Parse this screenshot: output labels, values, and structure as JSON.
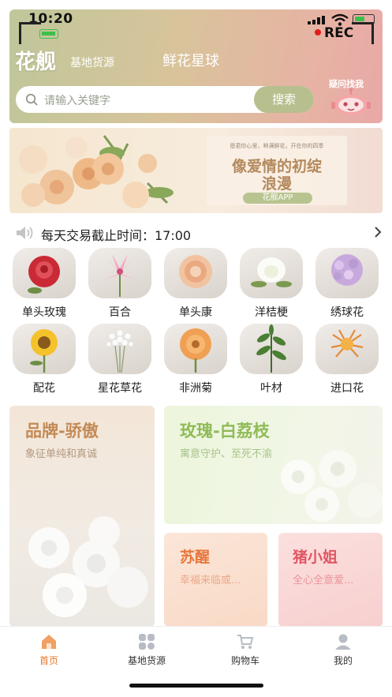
{
  "status": {
    "time": "10:20",
    "rec": "REC"
  },
  "header": {
    "logo": "花舰",
    "logo_sub": "基地货源",
    "app_name": "鲜花星球",
    "search_placeholder": "请输入关键字",
    "search_button": "搜索",
    "help_label": "疑问找我"
  },
  "banner": {
    "small_text": "愿君你心里，种满鲜花，开在你的四季",
    "title_line1": "像爱情的初绽",
    "title_line2": "浪漫",
    "button": "花舰APP"
  },
  "notice": {
    "text": "每天交易截止时间：17:00"
  },
  "categories": [
    {
      "label": "单头玫瑰",
      "icon": "red-rose-icon"
    },
    {
      "label": "百合",
      "icon": "lily-icon"
    },
    {
      "label": "单头康",
      "icon": "carnation-icon"
    },
    {
      "label": "洋桔梗",
      "icon": "eustoma-icon"
    },
    {
      "label": "绣球花",
      "icon": "hydrangea-icon"
    },
    {
      "label": "配花",
      "icon": "sunflower-icon"
    },
    {
      "label": "星花草花",
      "icon": "babys-breath-icon"
    },
    {
      "label": "非洲菊",
      "icon": "gerbera-icon"
    },
    {
      "label": "叶材",
      "icon": "leaf-icon"
    },
    {
      "label": "进口花",
      "icon": "imported-flower-icon"
    }
  ],
  "promo": {
    "brand": {
      "title": "品牌-骄傲",
      "subtitle": "象征单纯和真诚"
    },
    "rose": {
      "title": "玫瑰-白荔枝",
      "subtitle": "寓意守护、至死不渝"
    },
    "suxing": {
      "title": "苏醒",
      "subtitle": "幸福来临或..."
    },
    "zhu": {
      "title": "猪小姐",
      "subtitle": "全心全意爱..."
    }
  },
  "tabs": [
    {
      "label": "首页",
      "icon": "home-icon"
    },
    {
      "label": "基地货源",
      "icon": "grid-icon"
    },
    {
      "label": "购物车",
      "icon": "cart-icon"
    },
    {
      "label": "我的",
      "icon": "profile-icon"
    }
  ],
  "colors": {
    "active_tab": "#e8782a",
    "brand_title": "#c48a55",
    "rose_title": "#8fbb58",
    "coral_title": "#e8763a",
    "pink_title": "#e25462"
  }
}
